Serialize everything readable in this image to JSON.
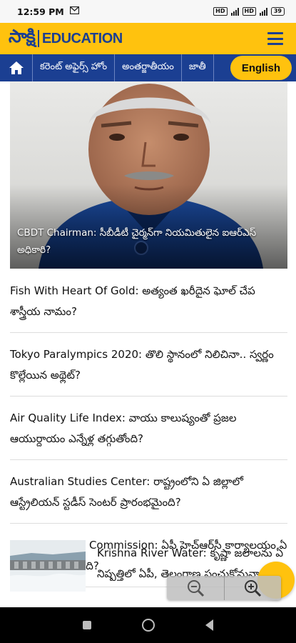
{
  "status_bar": {
    "time": "12:59 PM",
    "mail_icon": "M",
    "sim1_label": "HD",
    "sim2_label": "HD",
    "battery": "39"
  },
  "header": {
    "logo_main": "సాక్షి",
    "logo_sub": "EDUCATION",
    "menu_icon": "hamburger-icon",
    "brand_color": "#ffc20e",
    "accent_color": "#1b3f92"
  },
  "nav": {
    "home_icon": "home-icon",
    "items": [
      {
        "label": "కరెంట్ అఫైర్స్ హోం"
      },
      {
        "label": "అంతర్జాతీయం"
      },
      {
        "label": "జాతీ"
      }
    ],
    "english_button": "English"
  },
  "hero": {
    "caption": "CBDT Chairman: సీబీడీటీ చైర్మన్‌గా నియమితులైన ఐఆర్‌ఎస్ అధికారి?"
  },
  "articles": [
    {
      "title": "Fish With Heart Of Gold: అత్యంత ఖరీదైన ఘోల్ చేప శాస్త్రీయ నామం?"
    },
    {
      "title": "Tokyo Paralympics 2020: తొలి స్థానంలో నిలిచినా.. స్వర్ణం కొల్లేయిన అథ్లెట్?"
    },
    {
      "title": "Air Quality Life Index: వాయు కాలుష్యంతో ప్రజల ఆయుర్దాయం ఎన్నేళ్ల తగ్గుతోంది?"
    },
    {
      "title": "Australian Studies Center: రాష్ట్రంలోని ఏ జిల్లాలో ఆస్ట్రేలియన్ స్టడీస్ సెంటర్ ప్రారంభమైంది?"
    },
    {
      "title": "Human Rights Commission: ఏపీ హెచ్ఆర్‌సీ కార్యాలయం ఏ నగరంలో ఏర్పాటైంది?"
    }
  ],
  "thumb_article": {
    "title": "Krishna River Water: కృష్ణా జలాలను ఏ నిష్పత్తిలో ఏపీ, తెలంగాణ పంచుకోనున్నాయి?"
  },
  "zoom": {
    "zoom_out_icon": "zoom-out-icon",
    "zoom_in_icon": "zoom-in-icon"
  }
}
